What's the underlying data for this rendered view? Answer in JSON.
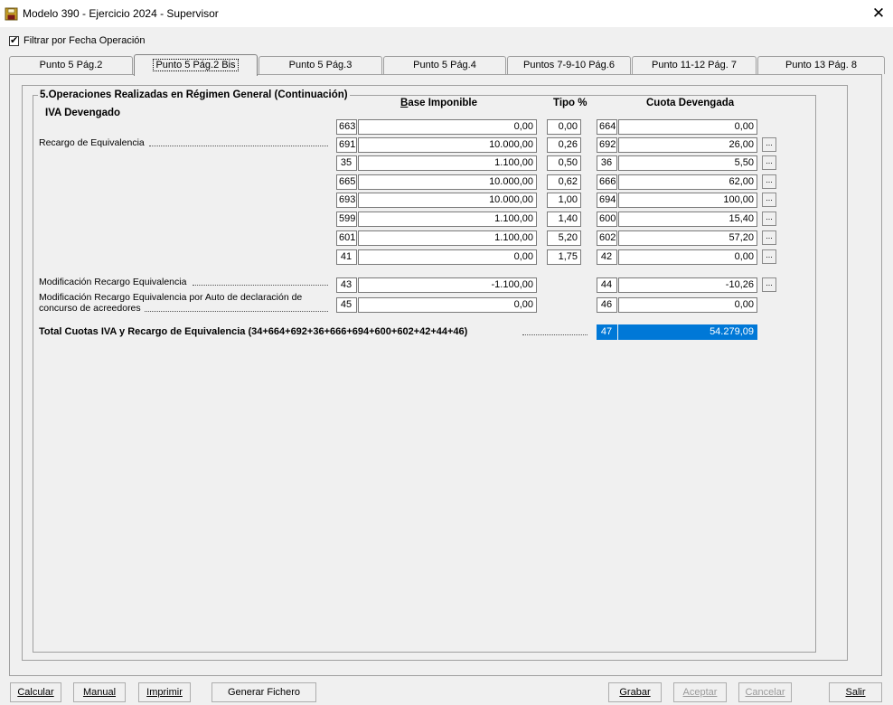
{
  "window": {
    "title": "Modelo 390 -  Ejercicio 2024 - Supervisor",
    "close_glyph": "✕"
  },
  "filter": {
    "label": "Filtrar por Fecha Operación",
    "checked": true
  },
  "tabs": [
    {
      "label": "Punto 5 Pág.2"
    },
    {
      "label": "Punto 5 Pág.2 Bis"
    },
    {
      "label": "Punto 5 Pág.3"
    },
    {
      "label": "Punto 5 Pág.4"
    },
    {
      "label": "Puntos 7-9-10 Pág.6"
    },
    {
      "label": "Punto 11-12 Pág. 7"
    },
    {
      "label": "Punto 13 Pág. 8"
    }
  ],
  "section": {
    "title": "5.Operaciones Realizadas en Régimen General (Continuación)",
    "subtitle": "IVA Devengado",
    "col_base_first": "B",
    "col_base_rest": "ase Imponible",
    "col_tipo": "Tipo %",
    "col_cuota": "Cuota Devengada"
  },
  "labels": {
    "recargo": "Recargo de Equivalencia",
    "mod_recargo": "Modificación Recargo Equivalencia",
    "mod_auto_1": "Modificación Recargo Equivalencia por Auto de declaración de",
    "mod_auto_2": "concurso de acreedores",
    "total": "Total Cuotas IVA y Recargo de Equivalencia (34+664+692+36+666+694+600+602+42+44+46)"
  },
  "rows": [
    {
      "c1": "663",
      "base": "0,00",
      "tipo": "0,00",
      "c2": "664",
      "cuota": "0,00"
    },
    {
      "c1": "691",
      "base": "10.000,00",
      "tipo": "0,26",
      "c2": "692",
      "cuota": "26,00"
    },
    {
      "c1": "35",
      "base": "1.100,00",
      "tipo": "0,50",
      "c2": "36",
      "cuota": "5,50"
    },
    {
      "c1": "665",
      "base": "10.000,00",
      "tipo": "0,62",
      "c2": "666",
      "cuota": "62,00"
    },
    {
      "c1": "693",
      "base": "10.000,00",
      "tipo": "1,00",
      "c2": "694",
      "cuota": "100,00"
    },
    {
      "c1": "599",
      "base": "1.100,00",
      "tipo": "1,40",
      "c2": "600",
      "cuota": "15,40"
    },
    {
      "c1": "601",
      "base": "1.100,00",
      "tipo": "5,20",
      "c2": "602",
      "cuota": "57,20"
    },
    {
      "c1": "41",
      "base": "0,00",
      "tipo": "1,75",
      "c2": "42",
      "cuota": "0,00"
    }
  ],
  "mod_rows": [
    {
      "c1": "43",
      "base": "-1.100,00",
      "c2": "44",
      "cuota": "-10,26"
    },
    {
      "c1": "45",
      "base": "0,00",
      "c2": "46",
      "cuota": "0,00"
    }
  ],
  "total_row": {
    "c": "47",
    "value": "54.279,09"
  },
  "ellipsis": "...",
  "buttons": {
    "calcular": "Calcular",
    "manual": "Manual",
    "imprimir": "Imprimir",
    "generar": "Generar Fichero",
    "grabar": "Grabar",
    "aceptar": "Aceptar",
    "cancelar": "Cancelar",
    "salir": "Salir"
  },
  "colors": {
    "selection": "#0078d7",
    "face": "#f0f0f0"
  }
}
